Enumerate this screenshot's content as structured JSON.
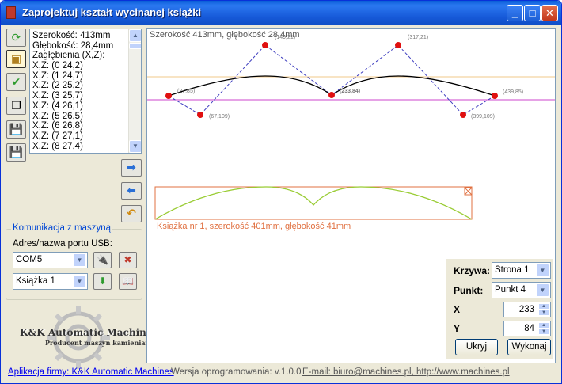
{
  "window": {
    "title": "Zaprojektuj kształt wycinanej książki",
    "minimize": "_",
    "maximize": "□",
    "close": "✕"
  },
  "toolbar": [
    {
      "icon": "refresh-green-icon"
    },
    {
      "icon": "image-picture-icon"
    },
    {
      "icon": "check-green-icon"
    },
    {
      "icon": "copy-documents-icon"
    },
    {
      "icon": "save-disk-add-icon"
    },
    {
      "icon": "save-disk-export-icon"
    }
  ],
  "list": {
    "items": [
      "Szerokość: 413mm",
      "Głębokość: 28,4mm",
      "Zagłębienia (X,Z):",
      "X,Z: (0 24,2)",
      "X,Z: (1 24,7)",
      "X,Z: (2 25,2)",
      "X,Z: (3 25,7)",
      "X,Z: (4 26,1)",
      "X,Z: (5 26,5)",
      "X,Z: (6 26,8)",
      "X,Z: (7 27,1)",
      "X,Z: (8 27,4)"
    ]
  },
  "arrows": {
    "right": "➡",
    "left": "⬅",
    "undo": "↶"
  },
  "comm": {
    "title": "Komunikacja z maszyną",
    "port_label": "Adres/nazwa portu USB:",
    "port_value": "COM5",
    "book_value": "Książka 1"
  },
  "logo": {
    "name": "K&K Automatic Machines",
    "sub": "Producent maszyn kamieniarskich"
  },
  "canvas": {
    "header": "Szerokość 413mm, głębokość 28,4mm",
    "points": [
      {
        "label": "(27,85)"
      },
      {
        "label": "(67,109)"
      },
      {
        "label": "(149,21)"
      },
      {
        "label": "(233,84)"
      },
      {
        "label": "(317,21)"
      },
      {
        "label": "(399,109)"
      },
      {
        "label": "(439,85)"
      }
    ],
    "book_caption": "Książka nr 1, szerokość 401mm, głębokość 41mm",
    "colors": {
      "control": "#4040c0",
      "point": "#e01010",
      "curve": "#000000",
      "book_curve": "#99cc33",
      "book_frame": "#e07040",
      "guide_top": "#f2c88a",
      "guide_mid": "#cc44cc"
    }
  },
  "panel": {
    "curve_label": "Krzywa:",
    "curve_value": "Strona 1",
    "point_label": "Punkt:",
    "point_value": "Punkt 4",
    "x_label": "X",
    "x_value": "233",
    "y_label": "Y",
    "y_value": "84",
    "hide_button": "Ukryj",
    "run_button": "Wykonaj"
  },
  "status": {
    "company_link": "Aplikacja firmy: K&K Automatic Machines",
    "version": "Wersja oprogramowania: v.1.0.0",
    "contact": "E-mail: biuro@machines.pl, http://www.machines.pl"
  }
}
